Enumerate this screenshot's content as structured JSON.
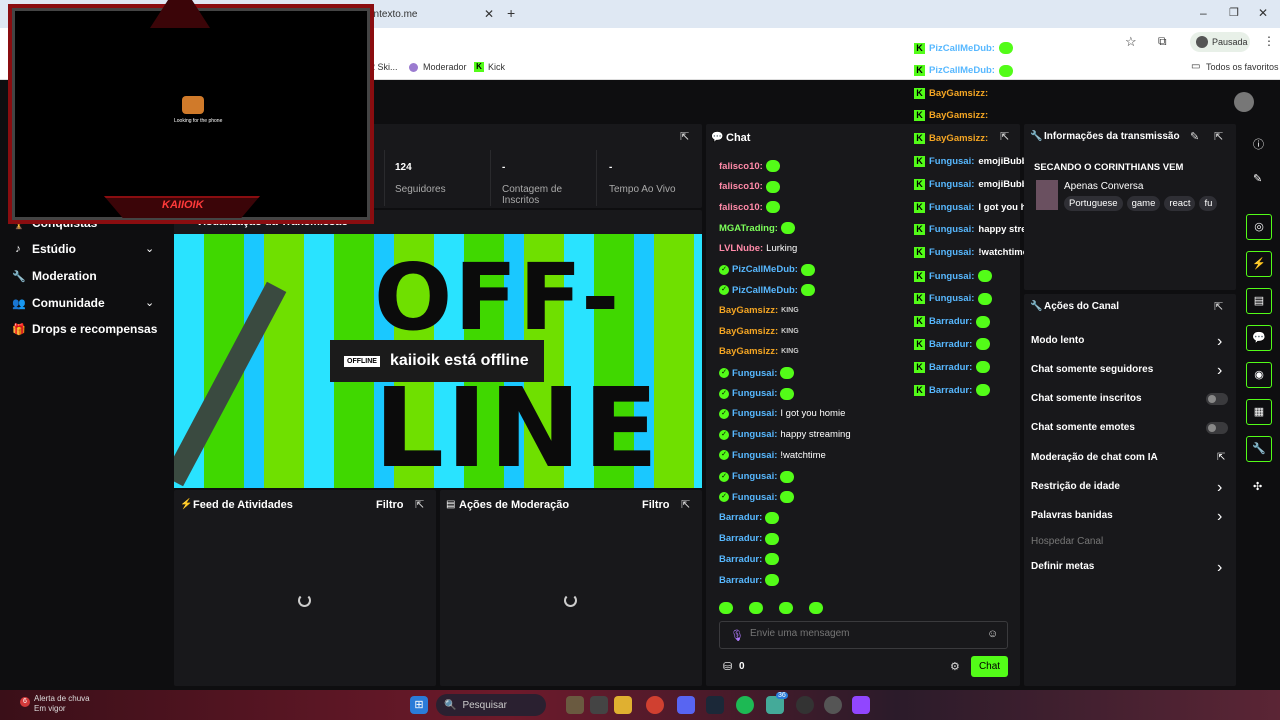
{
  "browser": {
    "tab_title_partial": "ontexto.me",
    "new_tab": "+",
    "profile_label": "Pausada",
    "bookmarks": [
      {
        "label": "2 Ski..."
      },
      {
        "label": "Moderador"
      },
      {
        "label": "Kick"
      }
    ],
    "all_bookmarks": "Todos os favoritos"
  },
  "overlay": {
    "logo_text": "KAIIOIK",
    "cam_text": "Looking for the phone"
  },
  "sidebar": {
    "items": [
      {
        "label": "Conquistas"
      },
      {
        "label": "Estúdio"
      },
      {
        "label": "Moderation"
      },
      {
        "label": "Comunidade"
      },
      {
        "label": "Drops e recompensas"
      }
    ]
  },
  "stats": [
    {
      "value": "124",
      "label": "Seguidores"
    },
    {
      "value": "-",
      "label": "Contagem de Inscritos"
    },
    {
      "value": "-",
      "label": "Tempo Ao Vivo"
    }
  ],
  "preview": {
    "title": "Visualização da Transmissão",
    "offline_badge": "OFFLINE",
    "offline_text": "kaiioik está offline",
    "bg_text_1": "OFF-",
    "bg_text_2": "LINE"
  },
  "activity_feed": {
    "title": "Feed de Atividades",
    "filter": "Filtro"
  },
  "mod_actions": {
    "title": "Ações de Moderação",
    "filter": "Filtro"
  },
  "chat": {
    "title": "Chat",
    "messages": [
      {
        "user": "falisco10",
        "text": "",
        "color": "#ff8aa8",
        "badge": false
      },
      {
        "user": "falisco10",
        "text": "",
        "color": "#ff8aa8",
        "badge": false
      },
      {
        "user": "falisco10",
        "text": "",
        "color": "#ff8aa8",
        "badge": false
      },
      {
        "user": "MGATrading",
        "text": "",
        "color": "#7dff5a",
        "badge": false
      },
      {
        "user": "LVLNube",
        "text": "Lurking",
        "color": "#ff8aa8",
        "badge": false
      },
      {
        "user": "PizCallMeDub",
        "text": "",
        "color": "#57b8ff",
        "badge": true
      },
      {
        "user": "PizCallMeDub",
        "text": "",
        "color": "#57b8ff",
        "badge": true
      },
      {
        "user": "BayGamsizz",
        "text": "KING",
        "color": "#f5a623",
        "badge": false
      },
      {
        "user": "BayGamsizz",
        "text": "KING",
        "color": "#f5a623",
        "badge": false
      },
      {
        "user": "BayGamsizz",
        "text": "KING",
        "color": "#f5a623",
        "badge": false
      },
      {
        "user": "Fungusai",
        "text": "",
        "color": "#57b8ff",
        "badge": true
      },
      {
        "user": "Fungusai",
        "text": "",
        "color": "#57b8ff",
        "badge": true
      },
      {
        "user": "Fungusai",
        "text": "I got you homie",
        "color": "#57b8ff",
        "badge": true
      },
      {
        "user": "Fungusai",
        "text": "happy streaming",
        "color": "#57b8ff",
        "badge": true
      },
      {
        "user": "Fungusai",
        "text": "!watchtime",
        "color": "#57b8ff",
        "badge": true
      },
      {
        "user": "Fungusai",
        "text": "",
        "color": "#57b8ff",
        "badge": true
      },
      {
        "user": "Fungusai",
        "text": "",
        "color": "#57b8ff",
        "badge": true
      },
      {
        "user": "Barradur",
        "text": "",
        "color": "#57b8ff",
        "badge": false
      },
      {
        "user": "Barradur",
        "text": "",
        "color": "#57b8ff",
        "badge": false
      },
      {
        "user": "Barradur",
        "text": "",
        "color": "#57b8ff",
        "badge": false
      },
      {
        "user": "Barradur",
        "text": "",
        "color": "#57b8ff",
        "badge": false
      }
    ],
    "input_placeholder": "Envie uma mensagem",
    "points": "0",
    "send_label": "Chat"
  },
  "overlay_chat": [
    {
      "user": "PizCallMeDub",
      "text": ""
    },
    {
      "user": "PizCallMeDub",
      "text": ""
    },
    {
      "user": "BayGamsizz",
      "text": ""
    },
    {
      "user": "BayGamsizz",
      "text": ""
    },
    {
      "user": "BayGamsizz",
      "text": ""
    },
    {
      "user": "Fungusai",
      "text": "emojiBubbly"
    },
    {
      "user": "Fungusai",
      "text": "emojiBubbly"
    },
    {
      "user": "Fungusai",
      "text": "I got you homie"
    },
    {
      "user": "Fungusai",
      "text": "happy streaming"
    },
    {
      "user": "Fungusai",
      "text": "!watchtime"
    },
    {
      "user": "Fungusai",
      "text": ""
    },
    {
      "user": "Fungusai",
      "text": ""
    },
    {
      "user": "Barradur",
      "text": ""
    },
    {
      "user": "Barradur",
      "text": ""
    },
    {
      "user": "Barradur",
      "text": ""
    },
    {
      "user": "Barradur",
      "text": ""
    }
  ],
  "stream_info": {
    "title": "Informações da transmissão",
    "stream_title": "SECANDO O CORINTHIANS VEM",
    "category": "Apenas Conversa",
    "tags": [
      "Portuguese",
      "game",
      "react",
      "fu"
    ]
  },
  "channel_actions": {
    "title": "Ações do Canal",
    "items": [
      {
        "label": "Modo lento",
        "control": "arrow"
      },
      {
        "label": "Chat somente seguidores",
        "control": "arrow"
      },
      {
        "label": "Chat somente inscritos",
        "control": "toggle"
      },
      {
        "label": "Chat somente emotes",
        "control": "toggle"
      },
      {
        "label": "Moderação de chat com IA",
        "control": "external"
      },
      {
        "label": "Restrição de idade",
        "control": "arrow"
      },
      {
        "label": "Palavras banidas",
        "control": "arrow"
      },
      {
        "label": "Hospedar Canal",
        "control": "none"
      },
      {
        "label": "Definir metas",
        "control": "arrow"
      }
    ]
  },
  "taskbar": {
    "weather_line1": "Alerta de chuva",
    "weather_line2": "Em vigor",
    "weather_count": "6",
    "search_placeholder": "Pesquisar",
    "chat_badge": "36"
  },
  "colors": {
    "accent": "#53fc18",
    "panel": "#18181b",
    "bg": "#0e0e10",
    "overlay_red": "#8a0d10"
  }
}
